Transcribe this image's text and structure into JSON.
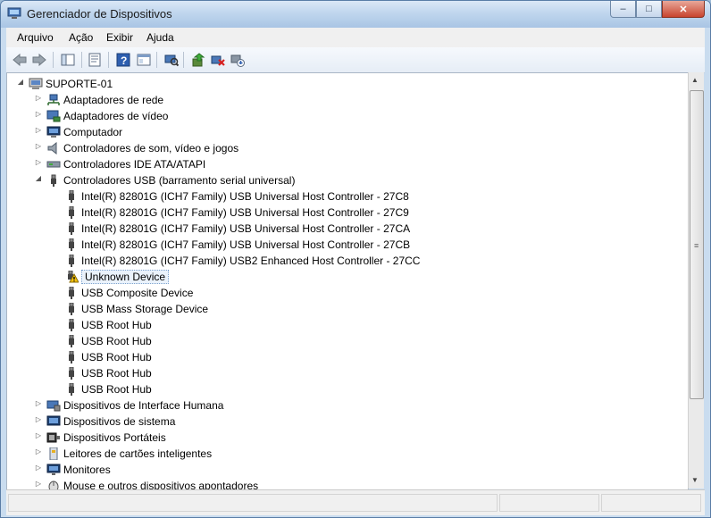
{
  "window": {
    "title": "Gerenciador de Dispositivos",
    "minimize": "–",
    "maximize": "□",
    "close": "✕"
  },
  "menu": [
    "Arquivo",
    "Ação",
    "Exibir",
    "Ajuda"
  ],
  "toolbar": [
    "back-icon",
    "forward-icon",
    "console-tree-icon",
    "properties-icon",
    "help-icon",
    "view-icon",
    "scan-icon",
    "update-driver-icon",
    "uninstall-icon",
    "disable-icon"
  ],
  "colors": {
    "title_bg": "#c0d6ee",
    "selection": "#eaf2fb",
    "warning": "#f4c20d"
  },
  "tree": {
    "root": "SUPORTE-01",
    "categories": [
      "Adaptadores de rede",
      "Adaptadores de vídeo",
      "Computador",
      "Controladores de som, vídeo e jogos",
      "Controladores IDE ATA/ATAPI",
      "Controladores USB (barramento serial universal)",
      "Dispositivos de Interface Humana",
      "Dispositivos de sistema",
      "Dispositivos Portáteis",
      "Leitores de cartões inteligentes",
      "Monitores",
      "Mouse e outros dispositivos apontadores"
    ],
    "usb_children": [
      "Intel(R) 82801G (ICH7 Family) USB Universal Host Controller - 27C8",
      "Intel(R) 82801G (ICH7 Family) USB Universal Host Controller - 27C9",
      "Intel(R) 82801G (ICH7 Family) USB Universal Host Controller - 27CA",
      "Intel(R) 82801G (ICH7 Family) USB Universal Host Controller - 27CB",
      "Intel(R) 82801G (ICH7 Family) USB2 Enhanced Host Controller - 27CC",
      "Unknown Device",
      "USB Composite Device",
      "USB Mass Storage Device",
      "USB Root Hub",
      "USB Root Hub",
      "USB Root Hub",
      "USB Root Hub",
      "USB Root Hub"
    ]
  }
}
